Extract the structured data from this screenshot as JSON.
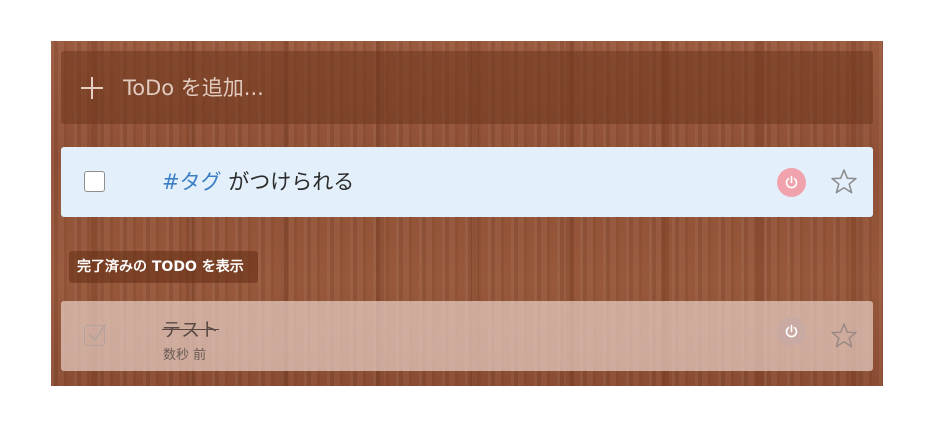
{
  "add_todo": {
    "placeholder": "ToDo を追加...",
    "icon": "plus-icon"
  },
  "tasks": [
    {
      "tag": "#タグ",
      "title_rest": " がつけられる",
      "completed": false,
      "power_icon": "power-icon",
      "star_icon": "star-outline-icon"
    }
  ],
  "toggle_completed_label": "完了済みの TODO を表示",
  "completed_tasks": [
    {
      "title": "テスト",
      "meta": "数秒 前",
      "completed": true,
      "power_icon": "power-icon",
      "star_icon": "star-outline-icon"
    }
  ],
  "colors": {
    "wood_base": "#8f5036",
    "active_task_bg": "#e3f0fb",
    "tag": "#3d7fc4",
    "power_active": "#f0a3ad",
    "power_muted": "#c9aaa2"
  }
}
